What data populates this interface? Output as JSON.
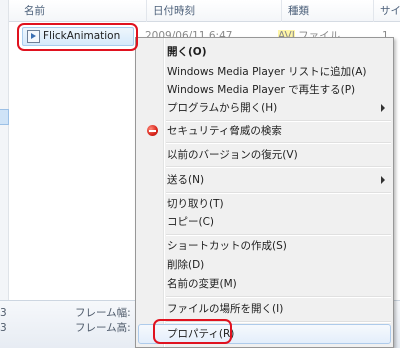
{
  "columns": {
    "name": "名前",
    "date": "日付時刻",
    "type": "種類",
    "size": "サイズ"
  },
  "file": {
    "name": "FlickAnimation",
    "date": "2009/06/11 6:47",
    "type_highlight": "AVI",
    "type_rest": " ファイル",
    "size": "1,",
    "icon": "video-file-icon"
  },
  "details": {
    "num_top": "3",
    "num_bottom": "3",
    "frame_width_label": "フレーム幅:",
    "frame_height_label": "フレーム高:"
  },
  "menu": {
    "open": "開く(O)",
    "add_to_list": "Windows Media Player リストに追加(A)",
    "play": "Windows Media Player で再生する(P)",
    "open_with": "プログラムから開く(H)",
    "security_scan": "セキュリティ脅威の検索",
    "restore_versions": "以前のバージョンの復元(V)",
    "send_to": "送る(N)",
    "cut": "切り取り(T)",
    "copy": "コピー(C)",
    "create_shortcut": "ショートカットの作成(S)",
    "delete": "削除(D)",
    "rename": "名前の変更(M)",
    "open_location": "ファイルの場所を開く(I)",
    "properties": "プロパティ(R)"
  },
  "colors": {
    "annotation": "#e0121f",
    "selection": "#d6eafb",
    "type_highlight": "#fff6a6"
  }
}
